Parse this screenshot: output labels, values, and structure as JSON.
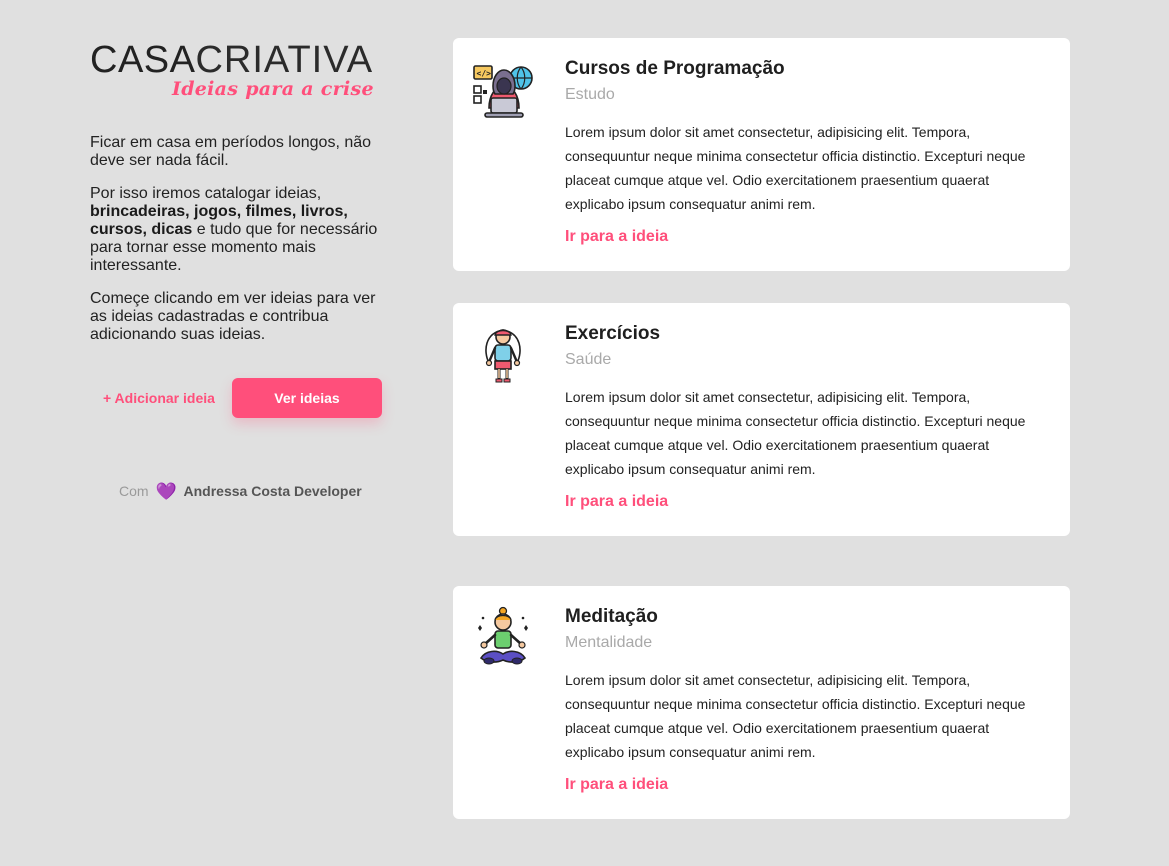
{
  "brand": {
    "name_part1": "CASA",
    "name_part2": "CRIATIVA",
    "tagline": "Ideias para a crise"
  },
  "intro": {
    "p1": "Ficar em casa em períodos longos, não deve ser nada fácil.",
    "p2_prefix": "Por isso iremos catalogar ideias, ",
    "p2_bold": "brincadeiras, jogos, filmes, livros, cursos, dicas",
    "p2_suffix": " e tudo que for necessário para tornar esse momento mais interessante.",
    "p3": "Começe clicando em ver ideias para ver as ideias cadastradas e contribua adicionando suas ideias."
  },
  "actions": {
    "add_label": "+ Adicionar ideia",
    "see_label": "Ver ideias"
  },
  "footer": {
    "prefix": "Com",
    "heart": "💜",
    "author": "Andressa Costa Developer"
  },
  "colors": {
    "accent": "#ff4f7b",
    "background": "#e0e0e0",
    "card": "#ffffff",
    "muted": "#a9a9a9"
  },
  "cards": [
    {
      "icon": "programmer-icon",
      "title": "Cursos de Programação",
      "category": "Estudo",
      "description": "Lorem ipsum dolor sit amet consectetur, adipisicing elit. Tempora, consequuntur neque minima consectetur officia distinctio. Excepturi neque placeat cumque atque vel. Odio exercitationem praesentium quaerat explicabo ipsum consequatur animi rem.",
      "link": "Ir para a ideia"
    },
    {
      "icon": "jump-rope-icon",
      "title": "Exercícios",
      "category": "Saúde",
      "description": "Lorem ipsum dolor sit amet consectetur, adipisicing elit. Tempora, consequuntur neque minima consectetur officia distinctio. Excepturi neque placeat cumque atque vel. Odio exercitationem praesentium quaerat explicabo ipsum consequatur animi rem.",
      "link": "Ir para a ideia"
    },
    {
      "icon": "meditation-icon",
      "title": "Meditação",
      "category": "Mentalidade",
      "description": "Lorem ipsum dolor sit amet consectetur, adipisicing elit. Tempora, consequuntur neque minima consectetur officia distinctio. Excepturi neque placeat cumque atque vel. Odio exercitationem praesentium quaerat explicabo ipsum consequatur animi rem.",
      "link": "Ir para a ideia"
    }
  ]
}
